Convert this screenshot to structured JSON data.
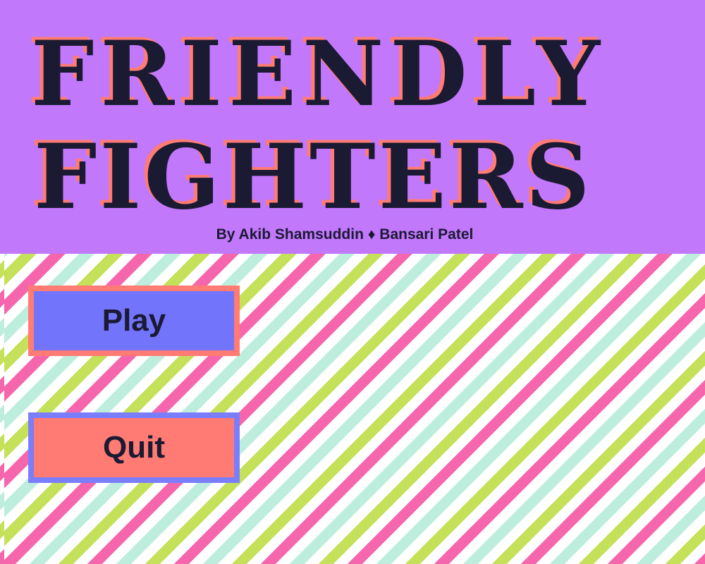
{
  "game": {
    "title_line_1": "Friendly",
    "title_line_2": "Fighters",
    "credits": "By Akib Shamsuddin ♦ Bansari Patel"
  },
  "menu": {
    "play_label": "Play",
    "quit_label": "Quit"
  },
  "colors": {
    "header_background": "#c278fb",
    "title_text": "#1b1a33",
    "title_shadow": "#ff7b73",
    "stripe_pink": "#f666ad",
    "stripe_green": "#c5e059",
    "stripe_mint": "#bdeedd",
    "stripe_white": "#ffffff",
    "play_fill": "#7274fb",
    "play_border": "#ff7b73",
    "quit_fill": "#ff7b73",
    "quit_border": "#7b7efb"
  }
}
